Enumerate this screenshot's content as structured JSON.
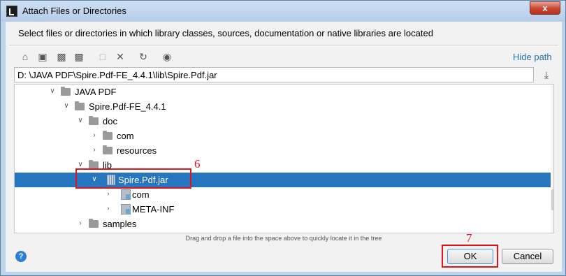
{
  "window": {
    "title": "Attach Files or Directories",
    "close_label": "x"
  },
  "description": "Select files or directories in which library classes, sources, documentation or native libraries are located",
  "toolbar": {
    "icons": [
      "home-icon",
      "desktop-icon",
      "project-icon",
      "module-icon",
      "new-folder-icon",
      "delete-icon",
      "refresh-icon",
      "show-hidden-icon"
    ],
    "hide_path_label": "Hide path"
  },
  "path_field": {
    "value": "D: \\JAVA PDF\\Spire.Pdf-FE_4.4.1\\lib\\Spire.Pdf.jar"
  },
  "tree": {
    "rows": [
      {
        "label": "JAVA PDF",
        "expanded": true,
        "type": "folder"
      },
      {
        "label": "Spire.Pdf-FE_4.4.1",
        "expanded": true,
        "type": "folder"
      },
      {
        "label": "doc",
        "expanded": true,
        "type": "folder"
      },
      {
        "label": "com",
        "expanded": false,
        "type": "folder"
      },
      {
        "label": "resources",
        "expanded": false,
        "type": "folder"
      },
      {
        "label": "lib",
        "expanded": true,
        "type": "folder"
      },
      {
        "label": "Spire.Pdf.jar",
        "expanded": true,
        "type": "jar",
        "selected": true
      },
      {
        "label": "com",
        "expanded": false,
        "type": "package"
      },
      {
        "label": "META-INF",
        "expanded": false,
        "type": "package"
      },
      {
        "label": "samples",
        "expanded": false,
        "type": "folder"
      }
    ]
  },
  "drag_hint": "Drag and drop a file into the space above to quickly locate it in the tree",
  "buttons": {
    "help_label": "?",
    "ok_label": "OK",
    "cancel_label": "Cancel"
  },
  "annotations": {
    "step_6": "6",
    "step_7": "7"
  },
  "colors": {
    "selection": "#2675bf",
    "annotation": "#e0141a",
    "link": "#2470b3"
  }
}
